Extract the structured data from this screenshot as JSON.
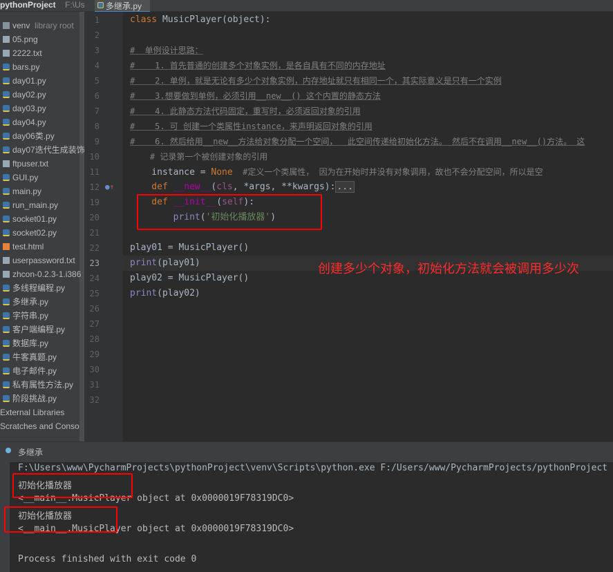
{
  "project": {
    "name": "pythonProject",
    "path": "F:\\Us"
  },
  "editor_tab": {
    "label": "多继承.py"
  },
  "sidebar": {
    "items": [
      {
        "label": "venv",
        "hint": "library root",
        "type": "folder"
      },
      {
        "label": "05.png",
        "type": "file"
      },
      {
        "label": "2222.txt",
        "type": "file"
      },
      {
        "label": "bars.py",
        "type": "py"
      },
      {
        "label": "day01.py",
        "type": "py"
      },
      {
        "label": "day02.py",
        "type": "py"
      },
      {
        "label": "day03.py",
        "type": "py"
      },
      {
        "label": "day04.py",
        "type": "py"
      },
      {
        "label": "day06类.py",
        "type": "py"
      },
      {
        "label": "day07迭代生成装饰",
        "type": "py"
      },
      {
        "label": "ftpuser.txt",
        "type": "file"
      },
      {
        "label": "GUI.py",
        "type": "py"
      },
      {
        "label": "main.py",
        "type": "py"
      },
      {
        "label": "run_main.py",
        "type": "py"
      },
      {
        "label": "socket01.py",
        "type": "py"
      },
      {
        "label": "socket02.py",
        "type": "py"
      },
      {
        "label": "test.html",
        "type": "html"
      },
      {
        "label": "userpassword.txt",
        "type": "file"
      },
      {
        "label": "zhcon-0.2.3-1.i386",
        "type": "file"
      },
      {
        "label": "多线程编程.py",
        "type": "py"
      },
      {
        "label": "多继承.py",
        "type": "py"
      },
      {
        "label": "字符串.py",
        "type": "py"
      },
      {
        "label": "客户端编程.py",
        "type": "py"
      },
      {
        "label": "数据库.py",
        "type": "py"
      },
      {
        "label": "牛客真题.py",
        "type": "py"
      },
      {
        "label": "电子邮件.py",
        "type": "py"
      },
      {
        "label": "私有属性方法.py",
        "type": "py"
      },
      {
        "label": "阶段挑战.py",
        "type": "py"
      },
      {
        "label": "External Libraries",
        "type": "lib"
      },
      {
        "label": "Scratches and Conso",
        "type": "lib"
      }
    ]
  },
  "line_numbers": [
    "1",
    "2",
    "3",
    "4",
    "5",
    "6",
    "7",
    "8",
    "9",
    "10",
    "11",
    "12",
    "19",
    "20",
    "21",
    "22",
    "23",
    "24",
    "25",
    "26",
    "27",
    "28",
    "29",
    "30",
    "31",
    "32"
  ],
  "code": {
    "l1_kw": "class ",
    "l1_name": "MusicPlayer",
    "l1_rest": "(object):",
    "l3": "#  单例设计思路：",
    "l4": "#    1. 首先普通的创建多个对象实例，是各自具有不同的内存地址",
    "l5": "#    2. 单例，就是无论有多少个对象实例，内存地址就只有相同一个，其实际意义是只有一个实例",
    "l6": "#    3.想要做到单例，必须引用__new__() 这个内置的静态方法",
    "l7": "#    4. 此静态方法代码固定，重写时，必须返回对象的引用",
    "l8": "#    5. 可 创建一个类属性instance，来声明返回对象的引用",
    "l9": "#    6. 然后给用__new__方法给对象分配一个空间，  此空间传递给初始化方法。 然后不在调用__new__()方法。 这",
    "l10": "    # 记录第一个被创建对象的引用",
    "l11_a": "    instance = ",
    "l11_b": "None",
    "l11_c": "  #定义一个类属性， 因为在开始时并没有对象调用，故也不会分配空间，所以是空",
    "l12_kw": "    def ",
    "l12_fn": "__new__",
    "l12_p1": "(",
    "l12_cls": "cls",
    "l12_p2": ", *args, **kwargs):",
    "l12_fold": "...",
    "l19_kw": "    def ",
    "l19_fn": "__init__",
    "l19_p1": "(",
    "l19_self": "self",
    "l19_p2": "):",
    "l20_bi": "        print",
    "l20_p1": "(",
    "l20_st": "'初始化播放器'",
    "l20_p2": ")",
    "l22": "play01 = MusicPlayer()",
    "l23_bi": "print",
    "l23_rest": "(play01)",
    "l24": "play02 = MusicPlayer()",
    "l25_bi": "print",
    "l25_rest": "(play02)"
  },
  "annotation": {
    "note": "创建多少个对象，初始化方法就会被调用多少次",
    "color": "#ff2a2a"
  },
  "run": {
    "tab_label": "多继承",
    "lines": [
      "F:\\Users\\www\\PycharmProjects\\pythonProject\\venv\\Scripts\\python.exe F:/Users/www/PycharmProjects/pythonProject",
      "初始化播放器",
      "<__main__.MusicPlayer object at 0x0000019F78319DC0>",
      "初始化播放器",
      "<__main__.MusicPlayer object at 0x0000019F78319DC0>",
      "",
      "Process finished with exit code 0"
    ]
  },
  "colors": {
    "background": "#2b2b2b",
    "panel": "#3c3f41",
    "keyword": "#cc7832",
    "string": "#6a8759",
    "comment": "#808080",
    "magic": "#b200b2"
  }
}
